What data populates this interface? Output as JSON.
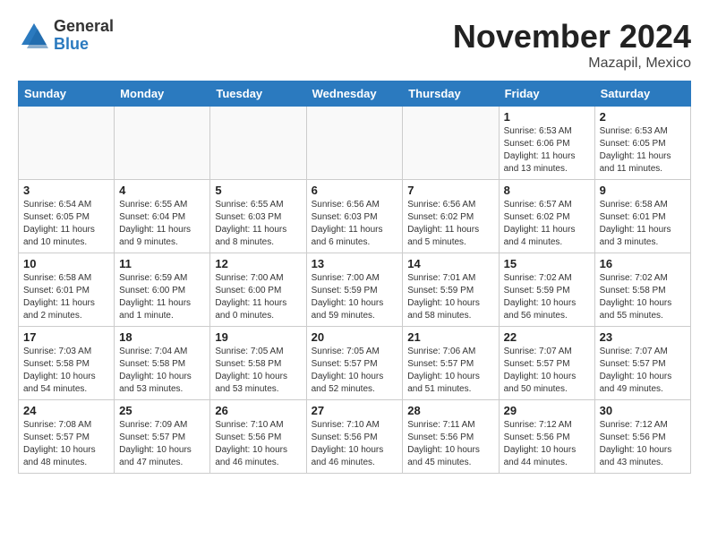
{
  "header": {
    "logo_general": "General",
    "logo_blue": "Blue",
    "month": "November 2024",
    "location": "Mazapil, Mexico"
  },
  "weekdays": [
    "Sunday",
    "Monday",
    "Tuesday",
    "Wednesday",
    "Thursday",
    "Friday",
    "Saturday"
  ],
  "weeks": [
    [
      {
        "day": "",
        "info": ""
      },
      {
        "day": "",
        "info": ""
      },
      {
        "day": "",
        "info": ""
      },
      {
        "day": "",
        "info": ""
      },
      {
        "day": "",
        "info": ""
      },
      {
        "day": "1",
        "info": "Sunrise: 6:53 AM\nSunset: 6:06 PM\nDaylight: 11 hours and 13 minutes."
      },
      {
        "day": "2",
        "info": "Sunrise: 6:53 AM\nSunset: 6:05 PM\nDaylight: 11 hours and 11 minutes."
      }
    ],
    [
      {
        "day": "3",
        "info": "Sunrise: 6:54 AM\nSunset: 6:05 PM\nDaylight: 11 hours and 10 minutes."
      },
      {
        "day": "4",
        "info": "Sunrise: 6:55 AM\nSunset: 6:04 PM\nDaylight: 11 hours and 9 minutes."
      },
      {
        "day": "5",
        "info": "Sunrise: 6:55 AM\nSunset: 6:03 PM\nDaylight: 11 hours and 8 minutes."
      },
      {
        "day": "6",
        "info": "Sunrise: 6:56 AM\nSunset: 6:03 PM\nDaylight: 11 hours and 6 minutes."
      },
      {
        "day": "7",
        "info": "Sunrise: 6:56 AM\nSunset: 6:02 PM\nDaylight: 11 hours and 5 minutes."
      },
      {
        "day": "8",
        "info": "Sunrise: 6:57 AM\nSunset: 6:02 PM\nDaylight: 11 hours and 4 minutes."
      },
      {
        "day": "9",
        "info": "Sunrise: 6:58 AM\nSunset: 6:01 PM\nDaylight: 11 hours and 3 minutes."
      }
    ],
    [
      {
        "day": "10",
        "info": "Sunrise: 6:58 AM\nSunset: 6:01 PM\nDaylight: 11 hours and 2 minutes."
      },
      {
        "day": "11",
        "info": "Sunrise: 6:59 AM\nSunset: 6:00 PM\nDaylight: 11 hours and 1 minute."
      },
      {
        "day": "12",
        "info": "Sunrise: 7:00 AM\nSunset: 6:00 PM\nDaylight: 11 hours and 0 minutes."
      },
      {
        "day": "13",
        "info": "Sunrise: 7:00 AM\nSunset: 5:59 PM\nDaylight: 10 hours and 59 minutes."
      },
      {
        "day": "14",
        "info": "Sunrise: 7:01 AM\nSunset: 5:59 PM\nDaylight: 10 hours and 58 minutes."
      },
      {
        "day": "15",
        "info": "Sunrise: 7:02 AM\nSunset: 5:59 PM\nDaylight: 10 hours and 56 minutes."
      },
      {
        "day": "16",
        "info": "Sunrise: 7:02 AM\nSunset: 5:58 PM\nDaylight: 10 hours and 55 minutes."
      }
    ],
    [
      {
        "day": "17",
        "info": "Sunrise: 7:03 AM\nSunset: 5:58 PM\nDaylight: 10 hours and 54 minutes."
      },
      {
        "day": "18",
        "info": "Sunrise: 7:04 AM\nSunset: 5:58 PM\nDaylight: 10 hours and 53 minutes."
      },
      {
        "day": "19",
        "info": "Sunrise: 7:05 AM\nSunset: 5:58 PM\nDaylight: 10 hours and 53 minutes."
      },
      {
        "day": "20",
        "info": "Sunrise: 7:05 AM\nSunset: 5:57 PM\nDaylight: 10 hours and 52 minutes."
      },
      {
        "day": "21",
        "info": "Sunrise: 7:06 AM\nSunset: 5:57 PM\nDaylight: 10 hours and 51 minutes."
      },
      {
        "day": "22",
        "info": "Sunrise: 7:07 AM\nSunset: 5:57 PM\nDaylight: 10 hours and 50 minutes."
      },
      {
        "day": "23",
        "info": "Sunrise: 7:07 AM\nSunset: 5:57 PM\nDaylight: 10 hours and 49 minutes."
      }
    ],
    [
      {
        "day": "24",
        "info": "Sunrise: 7:08 AM\nSunset: 5:57 PM\nDaylight: 10 hours and 48 minutes."
      },
      {
        "day": "25",
        "info": "Sunrise: 7:09 AM\nSunset: 5:57 PM\nDaylight: 10 hours and 47 minutes."
      },
      {
        "day": "26",
        "info": "Sunrise: 7:10 AM\nSunset: 5:56 PM\nDaylight: 10 hours and 46 minutes."
      },
      {
        "day": "27",
        "info": "Sunrise: 7:10 AM\nSunset: 5:56 PM\nDaylight: 10 hours and 46 minutes."
      },
      {
        "day": "28",
        "info": "Sunrise: 7:11 AM\nSunset: 5:56 PM\nDaylight: 10 hours and 45 minutes."
      },
      {
        "day": "29",
        "info": "Sunrise: 7:12 AM\nSunset: 5:56 PM\nDaylight: 10 hours and 44 minutes."
      },
      {
        "day": "30",
        "info": "Sunrise: 7:12 AM\nSunset: 5:56 PM\nDaylight: 10 hours and 43 minutes."
      }
    ]
  ]
}
